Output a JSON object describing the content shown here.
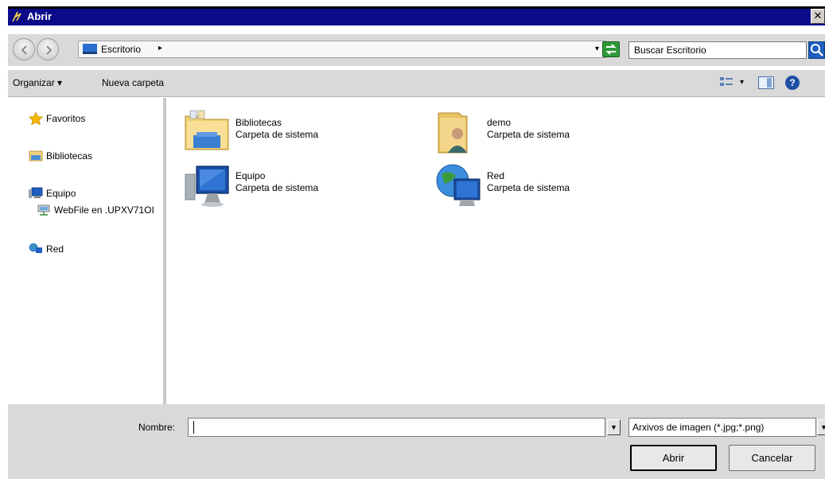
{
  "window": {
    "title": "Abrir",
    "close_glyph": "✕"
  },
  "address": {
    "location": "Escritorio",
    "breadcrumb_caret": "▸",
    "dropdown_glyph": "▾"
  },
  "search": {
    "placeholder": "Buscar Escritorio"
  },
  "toolbar": {
    "organize_label": "Organizar ▾",
    "new_folder_label": "Nueva carpeta",
    "view_caret": "▾",
    "help_glyph": "?"
  },
  "sidebar": {
    "items": [
      {
        "label": "Favoritos",
        "icon": "star-icon"
      },
      {
        "label": "Bibliotecas",
        "icon": "libraries-icon"
      },
      {
        "label": "Equipo",
        "icon": "computer-icon"
      },
      {
        "label": "WebFile en .UPXV71OI",
        "icon": "network-drive-icon"
      },
      {
        "label": "Red",
        "icon": "network-icon"
      }
    ]
  },
  "content": {
    "items": [
      {
        "name": "Bibliotecas",
        "type": "Carpeta de sistema",
        "icon": "libraries-icon"
      },
      {
        "name": "demo",
        "type": "Carpeta de sistema",
        "icon": "user-folder-icon"
      },
      {
        "name": "Equipo",
        "type": "Carpeta de sistema",
        "icon": "computer-icon"
      },
      {
        "name": "Red",
        "type": "Carpeta de sistema",
        "icon": "network-icon"
      }
    ]
  },
  "footer": {
    "filename_label": "Nombre:",
    "filename_value": "",
    "filetype_value": "Arxivos de imagen (*.jpg;*.png)",
    "open_label": "Abrir",
    "cancel_label": "Cancelar",
    "dropdown_glyph": "▼"
  }
}
